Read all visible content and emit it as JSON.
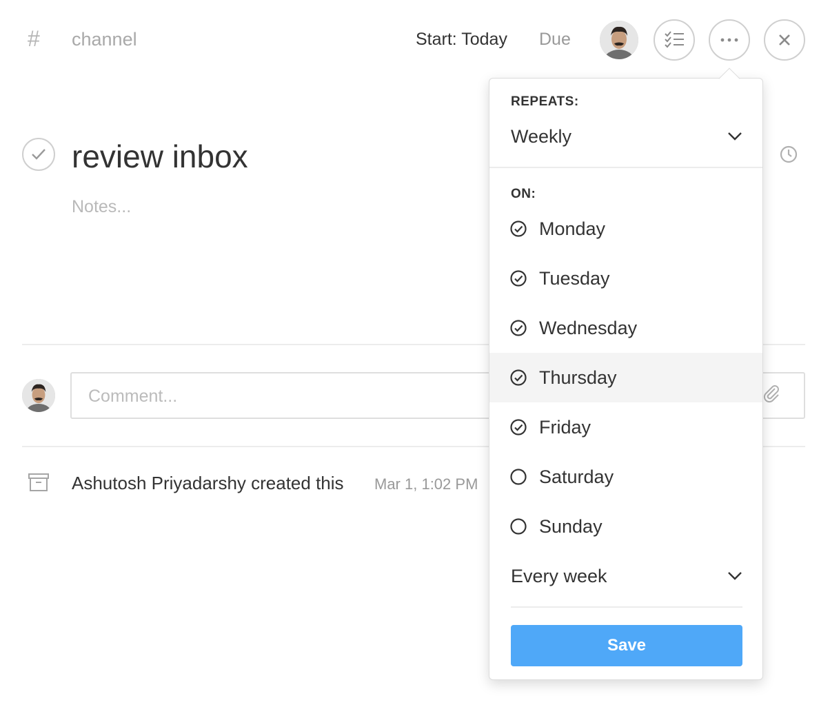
{
  "header": {
    "hash_symbol": "#",
    "channel": "channel",
    "start": "Start: Today",
    "due": "Due"
  },
  "task": {
    "title": "review inbox",
    "notes_placeholder": "Notes..."
  },
  "comment": {
    "placeholder": "Comment..."
  },
  "activity": {
    "text": "Ashutosh Priyadarshy created this",
    "time": "Mar 1, 1:02 PM"
  },
  "repeat_popover": {
    "repeats_label": "REPEATS:",
    "frequency": "Weekly",
    "on_label": "ON:",
    "days": [
      {
        "label": "Monday",
        "checked": true
      },
      {
        "label": "Tuesday",
        "checked": true
      },
      {
        "label": "Wednesday",
        "checked": true
      },
      {
        "label": "Thursday",
        "checked": true,
        "highlighted": true
      },
      {
        "label": "Friday",
        "checked": true
      },
      {
        "label": "Saturday",
        "checked": false
      },
      {
        "label": "Sunday",
        "checked": false
      }
    ],
    "interval": "Every week",
    "save_label": "Save"
  },
  "colors": {
    "accent": "#4fa8f8",
    "text": "#333333",
    "muted": "#999999",
    "border": "#dcdcdc",
    "highlight_row": "#f4f4f4"
  },
  "icons": {
    "checklist": "checklist-icon",
    "more": "more-horizontal-icon",
    "close": "close-icon",
    "clock": "clock-icon",
    "attachment": "paperclip-icon",
    "archive": "archive-icon",
    "chevron": "chevron-down-icon",
    "day_checked": "check-circle-icon",
    "day_unchecked": "circle-icon"
  }
}
